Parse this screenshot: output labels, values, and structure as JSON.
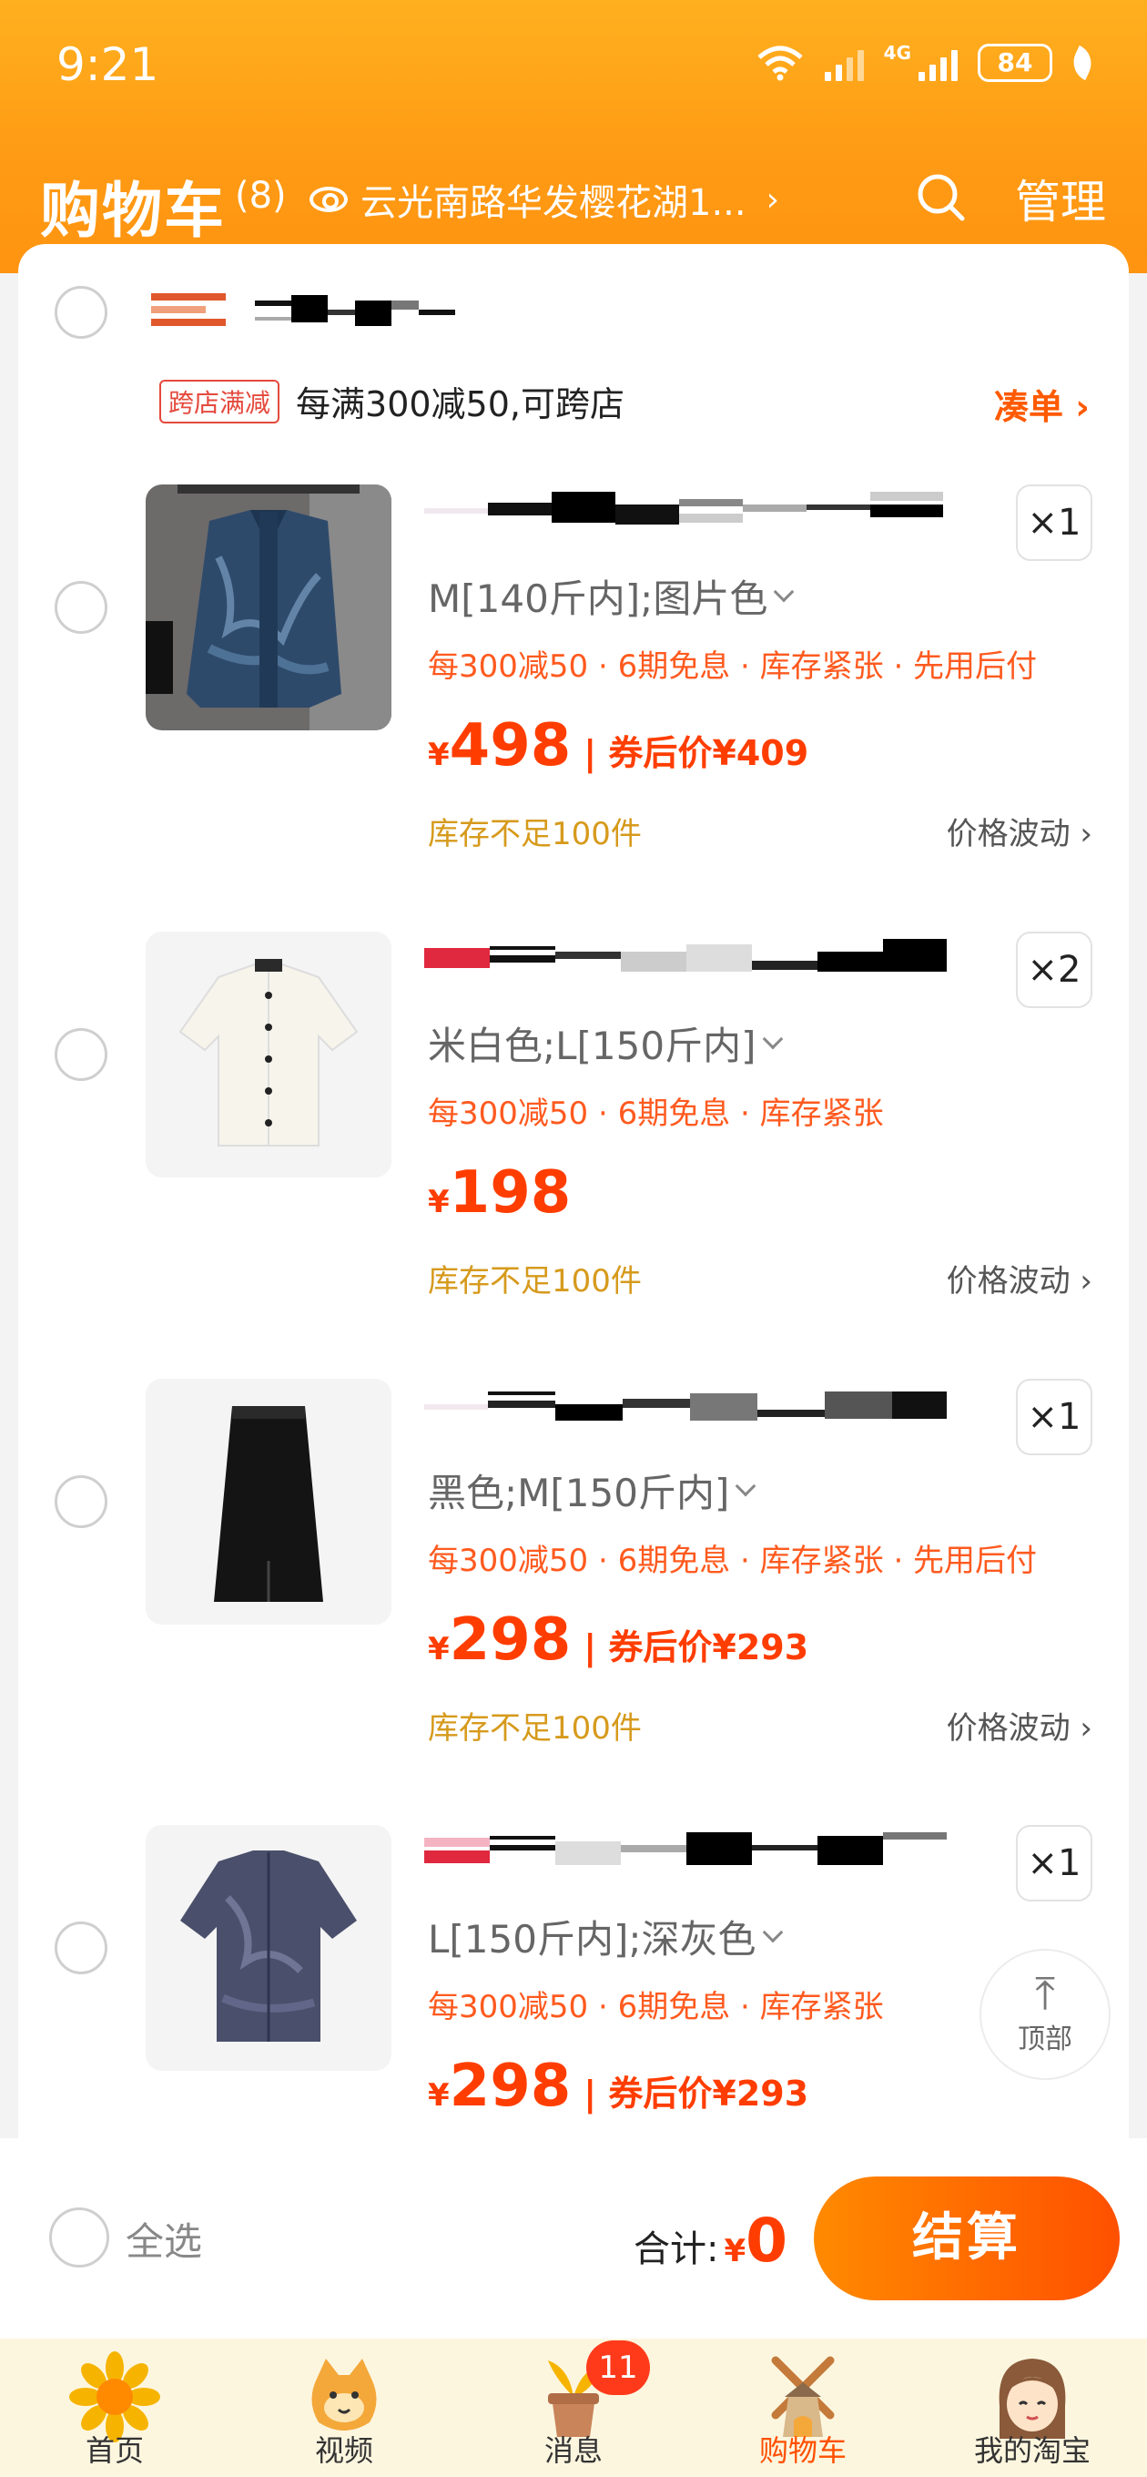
{
  "status_bar": {
    "time": "9:21",
    "network_label": "4G",
    "battery": "84"
  },
  "header": {
    "title": "购物车",
    "count": "(8)",
    "location": "云光南路华发樱花湖1...",
    "manage_label": "管理"
  },
  "shop": {
    "promo_tag": "跨店满减",
    "promo_text": "每满300减50,可跨店",
    "coudan_label": "凑单 ›"
  },
  "items": [
    {
      "sku": "M[140斤内];图片色",
      "tags": "每300减50 · 6期免息 · 库存紧张 · 先用后付",
      "yen": "¥",
      "price": "498",
      "coupon": "| 券后价¥409",
      "stock": "库存不足100件",
      "fluct": "价格波动 ›",
      "qty": "×1"
    },
    {
      "sku": "米白色;L[150斤内]",
      "tags": "每300减50 · 6期免息 · 库存紧张",
      "yen": "¥",
      "price": "198",
      "coupon": "",
      "stock": "库存不足100件",
      "fluct": "价格波动 ›",
      "qty": "×2"
    },
    {
      "sku": "黑色;M[150斤内]",
      "tags": "每300减50 · 6期免息 · 库存紧张 · 先用后付",
      "yen": "¥",
      "price": "298",
      "coupon": "| 券后价¥293",
      "stock": "库存不足100件",
      "fluct": "价格波动 ›",
      "qty": "×1"
    },
    {
      "sku": "L[150斤内];深灰色",
      "tags": "每300减50 · 6期免息 · 库存紧张",
      "yen": "¥",
      "price": "298",
      "coupon": "| 券后价¥293",
      "stock": "",
      "fluct": "",
      "qty": "×1"
    }
  ],
  "float": {
    "top_label": "顶部"
  },
  "checkout": {
    "select_all": "全选",
    "total_label": "合计:",
    "total_yen": "¥",
    "total_value": "0",
    "button": "结算"
  },
  "tabs": [
    {
      "label": "首页",
      "icon": "sunflower-icon"
    },
    {
      "label": "视频",
      "icon": "cat-mascot-icon"
    },
    {
      "label": "消息",
      "icon": "plant-pot-icon",
      "badge": "11"
    },
    {
      "label": "购物车",
      "icon": "windmill-cart-icon"
    },
    {
      "label": "我的淘宝",
      "icon": "girl-avatar-icon"
    }
  ],
  "colors": {
    "brand": "#ff9a14",
    "price": "#ff3d00",
    "tag": "#ff5a1f",
    "stock": "#d69a1c"
  }
}
